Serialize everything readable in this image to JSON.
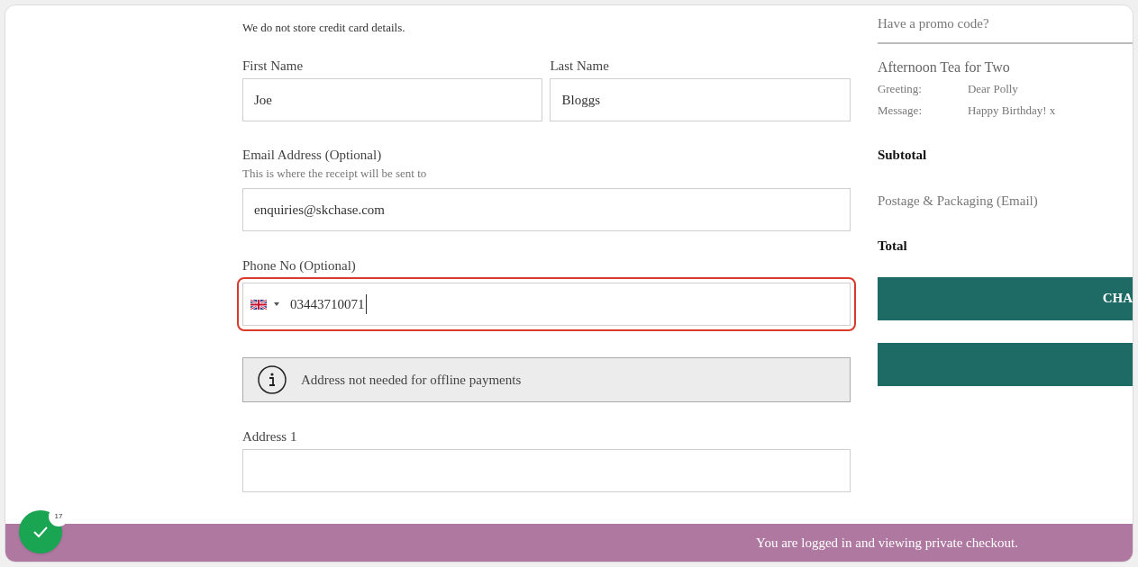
{
  "form": {
    "notice": "We do not store credit card details.",
    "first_name": {
      "label": "First Name",
      "value": "Joe"
    },
    "last_name": {
      "label": "Last Name",
      "value": "Bloggs"
    },
    "email": {
      "label": "Email Address (Optional)",
      "hint": "This is where the receipt will be sent to",
      "value": "enquiries@skchase.com"
    },
    "phone": {
      "label": "Phone No (Optional)",
      "value": "03443710071",
      "highlighted": true
    },
    "info": "Address not needed for offline payments",
    "address1": {
      "label": "Address 1"
    }
  },
  "summary": {
    "promo": "Have a promo code?",
    "product": "Afternoon Tea for Two",
    "details": [
      {
        "label": "Greeting:",
        "value": "Dear Polly"
      },
      {
        "label": "Message:",
        "value": "Happy Birthday! x"
      }
    ],
    "subtotal": "Subtotal",
    "postage": "Postage & Packaging (Email)",
    "total": "Total",
    "buttons": [
      {
        "kind": "filled",
        "label": "CHA"
      },
      {
        "kind": "filled"
      }
    ]
  },
  "banner": "You are logged in and viewing private checkout.",
  "check_badge": {
    "count": "17"
  }
}
